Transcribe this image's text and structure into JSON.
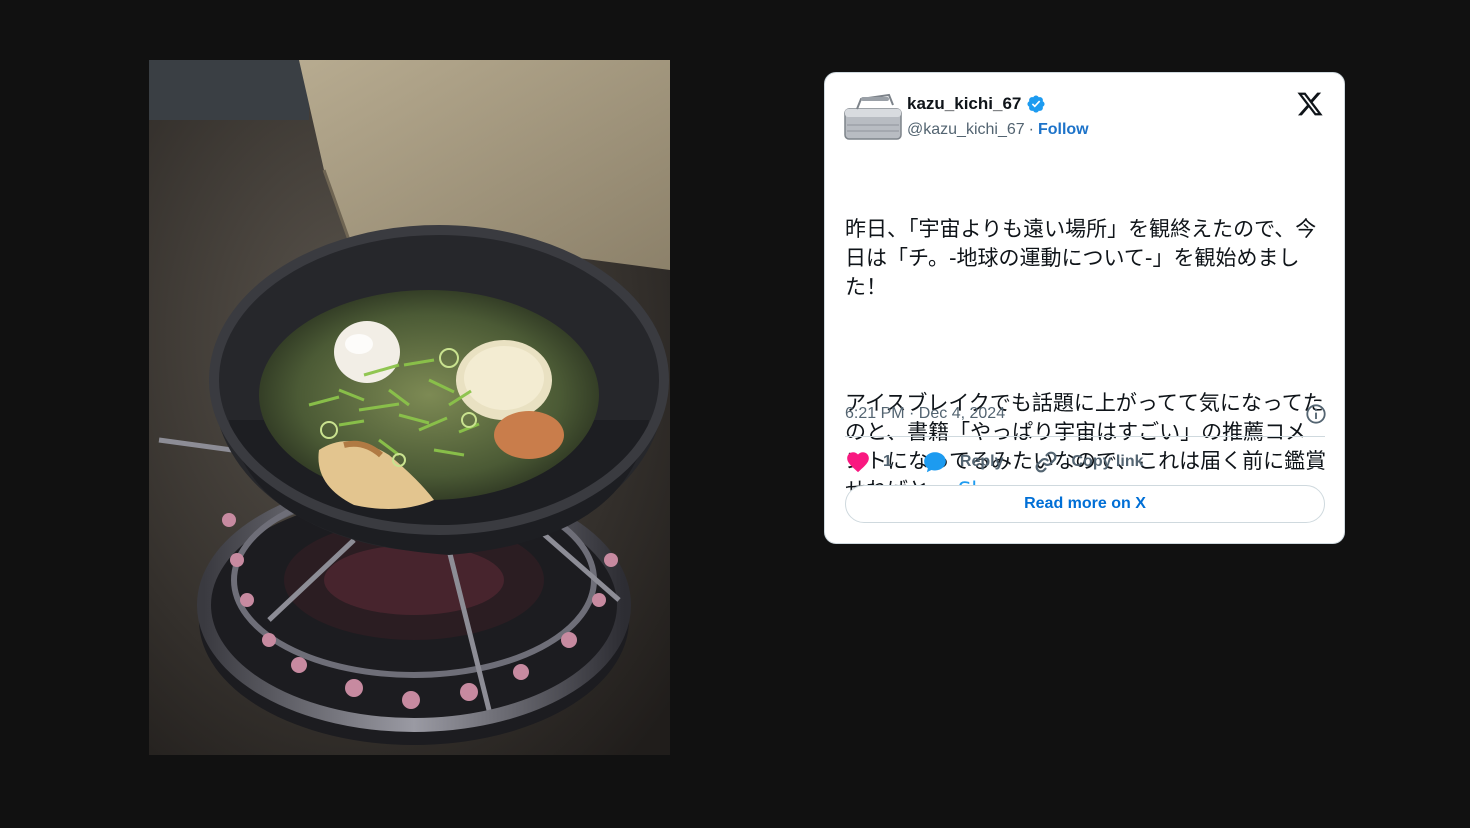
{
  "photo": {
    "icon": "camping-stove-pot-photo"
  },
  "tweet": {
    "display_name": "kazu_kichi_67",
    "handle": "@kazu_kichi_67",
    "separator": "·",
    "follow_label": "Follow",
    "text_para1": "昨日、「宇宙よりも遠い場所」を観終えたので、今日は「チ。-地球の運動について-」を観始めました！",
    "text_para2": "アイスブレイクでも話題に上がってて気になってたのと、書籍「やっぱり宇宙はすごい」の推薦コメントになってるみたいなので、これは届く前に鑑賞せねばと。",
    "show_more_label": "Show more",
    "timestamp": "6:21 PM · Dec 4, 2024",
    "like_count": "1",
    "reply_label": "Reply",
    "copy_link_label": "Copy link",
    "read_more_label": "Read more on X"
  },
  "colors": {
    "page_background": "#111111",
    "card_background": "#ffffff",
    "link_blue": "#1d9bf0",
    "follow_blue": "#1d73c9",
    "heart_pink": "#f91880",
    "verified_blue": "#1d9bf0",
    "muted_text": "#536471",
    "text": "#0f1419"
  },
  "icons": {
    "logo": "x-logo-icon",
    "verified": "verified-badge-icon",
    "info": "info-icon",
    "like": "heart-icon",
    "reply": "speech-bubble-icon",
    "copy": "link-icon"
  }
}
